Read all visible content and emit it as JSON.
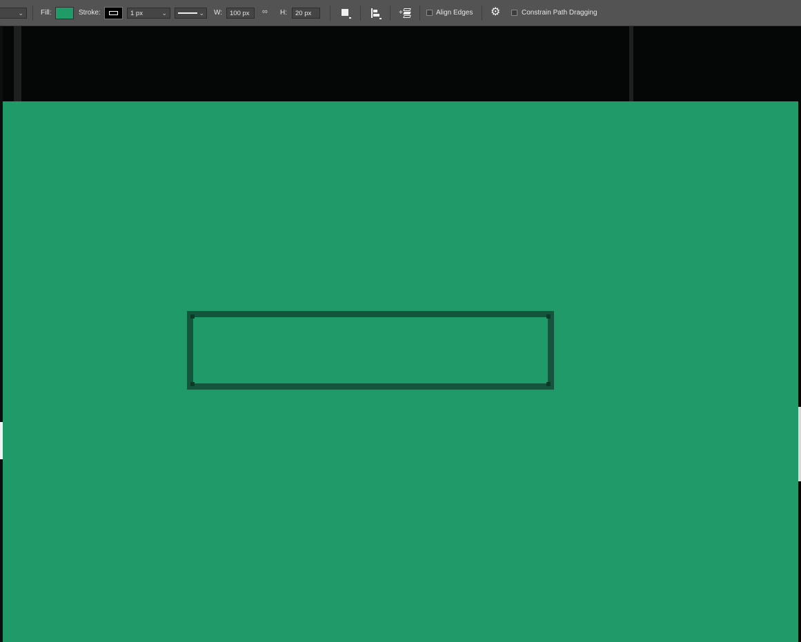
{
  "toolbar": {
    "fill_label": "Fill:",
    "fill_color": "#209a69",
    "stroke_label": "Stroke:",
    "stroke_width": "1 px",
    "width_label": "W:",
    "width_value": "100 px",
    "height_label": "H:",
    "height_value": "20 px",
    "align_edges_label": "Align Edges",
    "align_edges_checked": false,
    "constrain_label": "Constrain Path Dragging",
    "constrain_checked": false,
    "icons": [
      "dropdown-icon",
      "stroke-swatch-icon",
      "stroke-style-icon",
      "link-icon",
      "path-operations-icon",
      "path-alignment-icon",
      "path-arrangement-icon",
      "gear-icon"
    ]
  },
  "canvas": {
    "background_color": "#209a69",
    "shape_stroke_color": "#16553d"
  }
}
